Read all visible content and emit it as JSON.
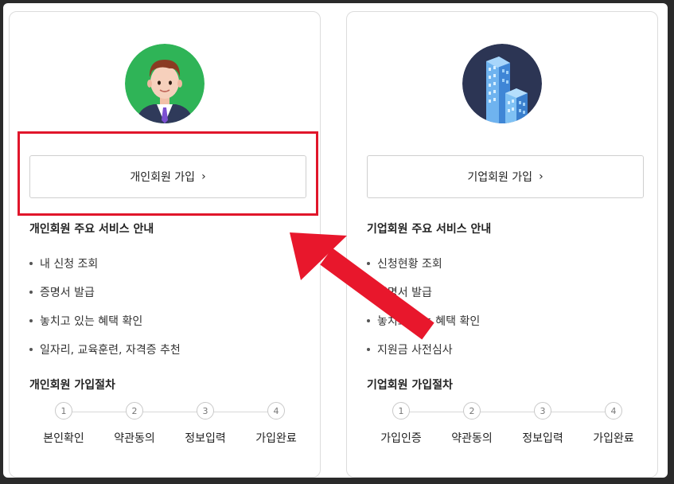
{
  "personal": {
    "join_label": "개인회원 가입",
    "services_title": "개인회원 주요 서비스 안내",
    "services": [
      "내 신청 조회",
      "증명서 발급",
      "놓치고 있는 혜택 확인",
      "일자리, 교육훈련, 자격증 추천"
    ],
    "process_title": "개인회원 가입절차",
    "steps": [
      {
        "num": "1",
        "label": "본인확인"
      },
      {
        "num": "2",
        "label": "약관동의"
      },
      {
        "num": "3",
        "label": "정보입력"
      },
      {
        "num": "4",
        "label": "가입완료"
      }
    ]
  },
  "business": {
    "join_label": "기업회원 가입",
    "services_title": "기업회원 주요 서비스 안내",
    "services": [
      "신청현황 조회",
      "증명서 발급",
      "놓치고 있는 혜택 확인",
      "지원금 사전심사"
    ],
    "process_title": "기업회원 가입절차",
    "steps": [
      {
        "num": "1",
        "label": "가입인증"
      },
      {
        "num": "2",
        "label": "약관동의"
      },
      {
        "num": "3",
        "label": "정보입력"
      },
      {
        "num": "4",
        "label": "가입완료"
      }
    ]
  },
  "colors": {
    "highlight": "#e0162b",
    "arrow": "#e8172c",
    "person_bg": "#2fb457",
    "building_bg": "#2c3554"
  },
  "icons": {
    "person": "person-avatar-icon",
    "building": "building-icon",
    "chevron": "chevron-right-icon"
  }
}
